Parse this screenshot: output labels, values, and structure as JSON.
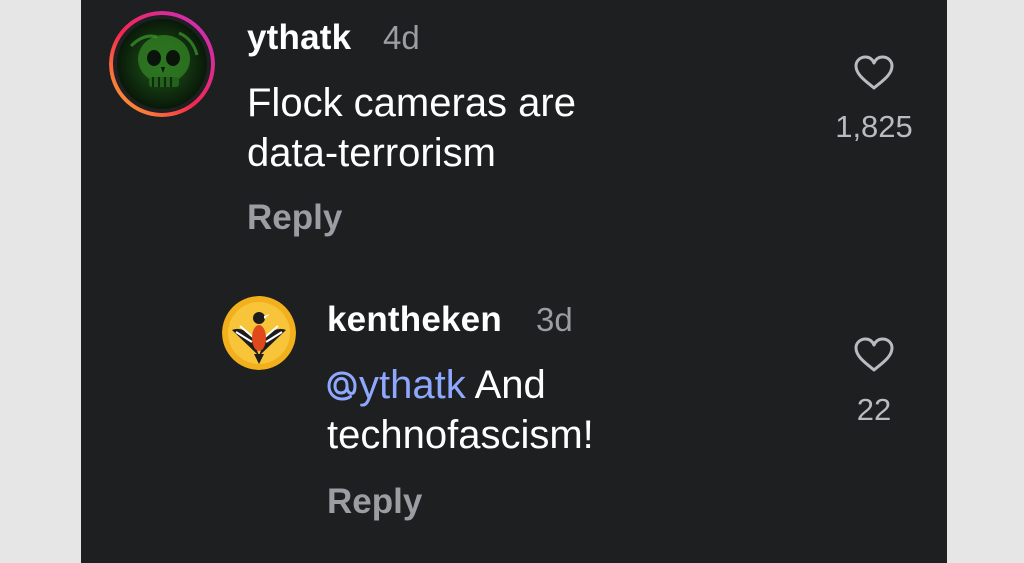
{
  "comments": [
    {
      "username": "ythatk",
      "time": "4d",
      "text_line1": "Flock cameras are",
      "text_line2": "data-terrorism",
      "reply_label": "Reply",
      "likes": "1,825",
      "avatar_icon": "green-skull-avatar"
    },
    {
      "username": "kentheken",
      "time": "3d",
      "mention": "ythatk",
      "text_after_mention": " And",
      "text_line2": "technofascism!",
      "reply_label": "Reply",
      "likes": "22",
      "avatar_icon": "phoenix-bird-avatar"
    }
  ],
  "colors": {
    "background": "#1d1f21",
    "mention": "#8fa8ff",
    "muted": "#9a9ea3"
  }
}
